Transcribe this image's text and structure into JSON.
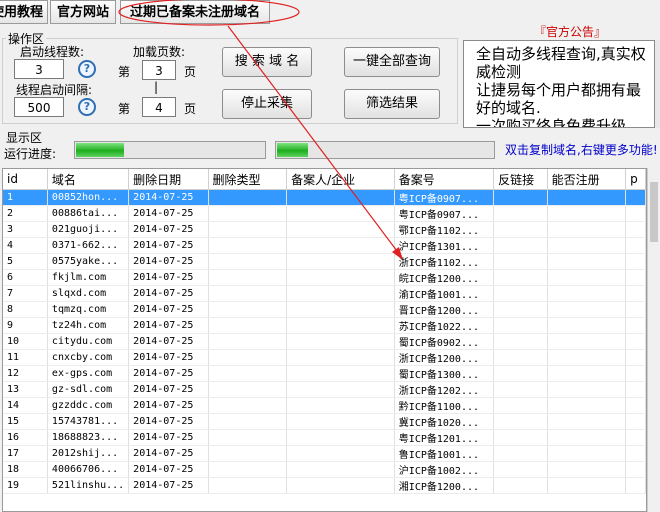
{
  "toolbar": {
    "tutorial": "使用教程",
    "website": "官方网站",
    "expired": "过期已备案未注册域名"
  },
  "ops": {
    "legend": "操作区",
    "threads_label": "启动线程数:",
    "threads_value": "3",
    "interval_label": "线程启动间隔:",
    "interval_value": "500",
    "pages_label": "加载页数:",
    "page_prefix": "第",
    "page_from": "3",
    "page_to": "4",
    "page_suffix": "页",
    "separator": "|",
    "help": "?",
    "search_btn": "搜 索 域 名",
    "stop_btn": "停止采集",
    "query_all_btn": "一键全部查询",
    "filter_btn": "筛选结果"
  },
  "notice": {
    "title": "『官方公告』",
    "lines": [
      "全自动多线程查询,真实权威检测",
      "让捷易每个用户都拥有最好的域名.",
      "一次购买终身免费升级"
    ]
  },
  "display": {
    "legend": "显示区",
    "progress_label": "运行进度:",
    "hint": "双击复制域名,右键更多功能!",
    "progress1": 0.25,
    "progress2": 0.14
  },
  "colors": {
    "accent": "#3399ff",
    "hint": "#0000cc",
    "progress": "#1fae1f",
    "notice_title": "#cc0000"
  },
  "table": {
    "headers": [
      "id",
      "域名",
      "删除日期",
      "删除类型",
      "备案人/企业",
      "备案号",
      "反链接",
      "能否注册",
      "p"
    ],
    "rows": [
      [
        "1",
        "00852hon...",
        "2014-07-25",
        "",
        "",
        "粤ICP备0907...",
        "",
        ""
      ],
      [
        "2",
        "00886tai...",
        "2014-07-25",
        "",
        "",
        "粤ICP备0907...",
        "",
        ""
      ],
      [
        "3",
        "021guoji...",
        "2014-07-25",
        "",
        "",
        "鄂ICP备1102...",
        "",
        ""
      ],
      [
        "4",
        "0371-662...",
        "2014-07-25",
        "",
        "",
        "沪ICP备1301...",
        "",
        ""
      ],
      [
        "5",
        "0575yake...",
        "2014-07-25",
        "",
        "",
        "浙ICP备1102...",
        "",
        ""
      ],
      [
        "6",
        "fkjlm.com",
        "2014-07-25",
        "",
        "",
        "皖ICP备1200...",
        "",
        ""
      ],
      [
        "7",
        "slqxd.com",
        "2014-07-25",
        "",
        "",
        "渝ICP备1001...",
        "",
        ""
      ],
      [
        "8",
        "tqmzq.com",
        "2014-07-25",
        "",
        "",
        "晋ICP备1200...",
        "",
        ""
      ],
      [
        "9",
        "tz24h.com",
        "2014-07-25",
        "",
        "",
        "苏ICP备1022...",
        "",
        ""
      ],
      [
        "10",
        "citydu.com",
        "2014-07-25",
        "",
        "",
        "蜀ICP备0902...",
        "",
        ""
      ],
      [
        "11",
        "cnxcby.com",
        "2014-07-25",
        "",
        "",
        "浙ICP备1200...",
        "",
        ""
      ],
      [
        "12",
        "ex-gps.com",
        "2014-07-25",
        "",
        "",
        "蜀ICP备1300...",
        "",
        ""
      ],
      [
        "13",
        "gz-sdl.com",
        "2014-07-25",
        "",
        "",
        "浙ICP备1202...",
        "",
        ""
      ],
      [
        "14",
        "gzzddc.com",
        "2014-07-25",
        "",
        "",
        "黔ICP备1100...",
        "",
        ""
      ],
      [
        "15",
        "15743781...",
        "2014-07-25",
        "",
        "",
        "冀ICP备1020...",
        "",
        ""
      ],
      [
        "16",
        "18688823...",
        "2014-07-25",
        "",
        "",
        "粤ICP备1201...",
        "",
        ""
      ],
      [
        "17",
        "2012shij...",
        "2014-07-25",
        "",
        "",
        "鲁ICP备1001...",
        "",
        ""
      ],
      [
        "18",
        "40066706...",
        "2014-07-25",
        "",
        "",
        "沪ICP备1002...",
        "",
        ""
      ],
      [
        "19",
        "521linshu...",
        "2014-07-25",
        "",
        "",
        "湘ICP备1200...",
        "",
        ""
      ]
    ]
  }
}
